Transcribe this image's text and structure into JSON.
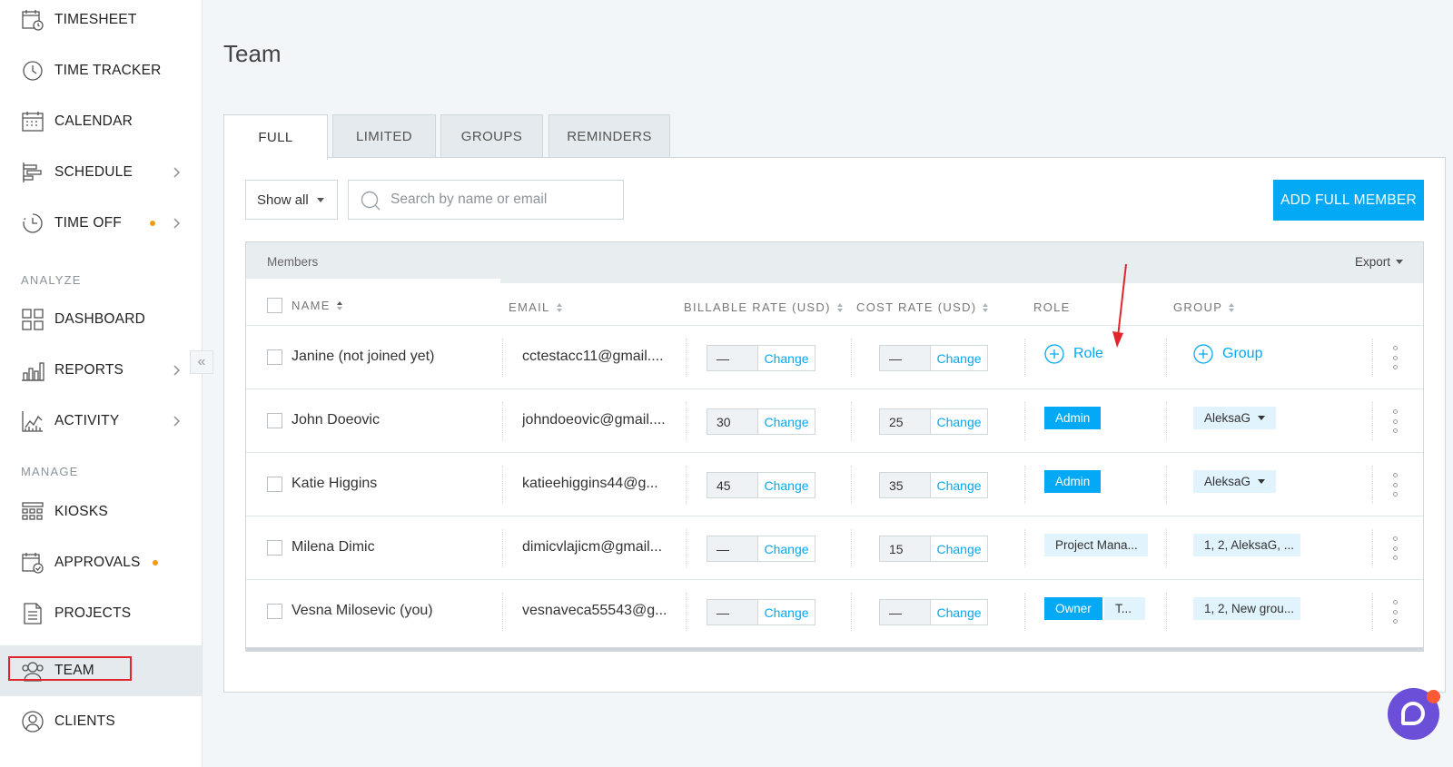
{
  "sidebar": {
    "items": [
      {
        "label": "TIMESHEET",
        "icon": "timesheet-icon"
      },
      {
        "label": "TIME TRACKER",
        "icon": "clock-icon"
      },
      {
        "label": "CALENDAR",
        "icon": "calendar-icon"
      },
      {
        "label": "SCHEDULE",
        "icon": "schedule-icon",
        "chevron": true
      },
      {
        "label": "TIME OFF",
        "icon": "time-off-icon",
        "chevron": true,
        "dot": true
      },
      {
        "label": "DASHBOARD",
        "icon": "dashboard-icon"
      },
      {
        "label": "REPORTS",
        "icon": "reports-icon",
        "chevron": true
      },
      {
        "label": "ACTIVITY",
        "icon": "activity-icon",
        "chevron": true
      },
      {
        "label": "KIOSKS",
        "icon": "kiosks-icon"
      },
      {
        "label": "APPROVALS",
        "icon": "approvals-icon",
        "dot": true
      },
      {
        "label": "PROJECTS",
        "icon": "projects-icon"
      },
      {
        "label": "TEAM",
        "icon": "team-icon",
        "active": true
      },
      {
        "label": "CLIENTS",
        "icon": "clients-icon"
      }
    ],
    "sections": {
      "analyze": "ANALYZE",
      "manage": "MANAGE"
    },
    "collapse_glyph": "«"
  },
  "page": {
    "title": "Team"
  },
  "tabs": [
    {
      "label": "FULL",
      "active": true
    },
    {
      "label": "LIMITED"
    },
    {
      "label": "GROUPS"
    },
    {
      "label": "REMINDERS"
    }
  ],
  "toolbar": {
    "filter_label": "Show all",
    "search_placeholder": "Search by name or email",
    "add_button": "ADD FULL MEMBER"
  },
  "table": {
    "section_label": "Members",
    "export_label": "Export",
    "columns": {
      "name": "NAME",
      "email": "EMAIL",
      "billable": "BILLABLE RATE (USD)",
      "cost": "COST RATE (USD)",
      "role": "ROLE",
      "group": "GROUP"
    },
    "change_label": "Change",
    "rows": [
      {
        "name": "Janine (not joined yet)",
        "email": "cctestacc11@gmail....",
        "billable": "—",
        "cost": "—",
        "role_add": "Role",
        "group_add": "Group"
      },
      {
        "name": "John Doeovic",
        "email": "johndoeovic@gmail....",
        "billable": "30",
        "cost": "25",
        "role": "Admin",
        "group": "AleksaG"
      },
      {
        "name": "Katie Higgins",
        "email": "katieehiggins44@g...",
        "billable": "45",
        "cost": "35",
        "role": "Admin",
        "group": "AleksaG"
      },
      {
        "name": "Milena Dimic",
        "email": "dimicvlajicm@gmail...",
        "billable": "—",
        "cost": "15",
        "role": "Project Mana...",
        "group": "1, 2, AleksaG, ..."
      },
      {
        "name": "Vesna Milosevic (you)",
        "email": "vesnaveca55543@g...",
        "billable": "—",
        "cost": "—",
        "role": "Owner",
        "role2": "T...",
        "group": "1, 2, New grou..."
      }
    ]
  },
  "colors": {
    "accent": "#03a9f4",
    "highlight": "#e0262b",
    "chat": "#6b4fd8",
    "dot": "#f39c12"
  }
}
